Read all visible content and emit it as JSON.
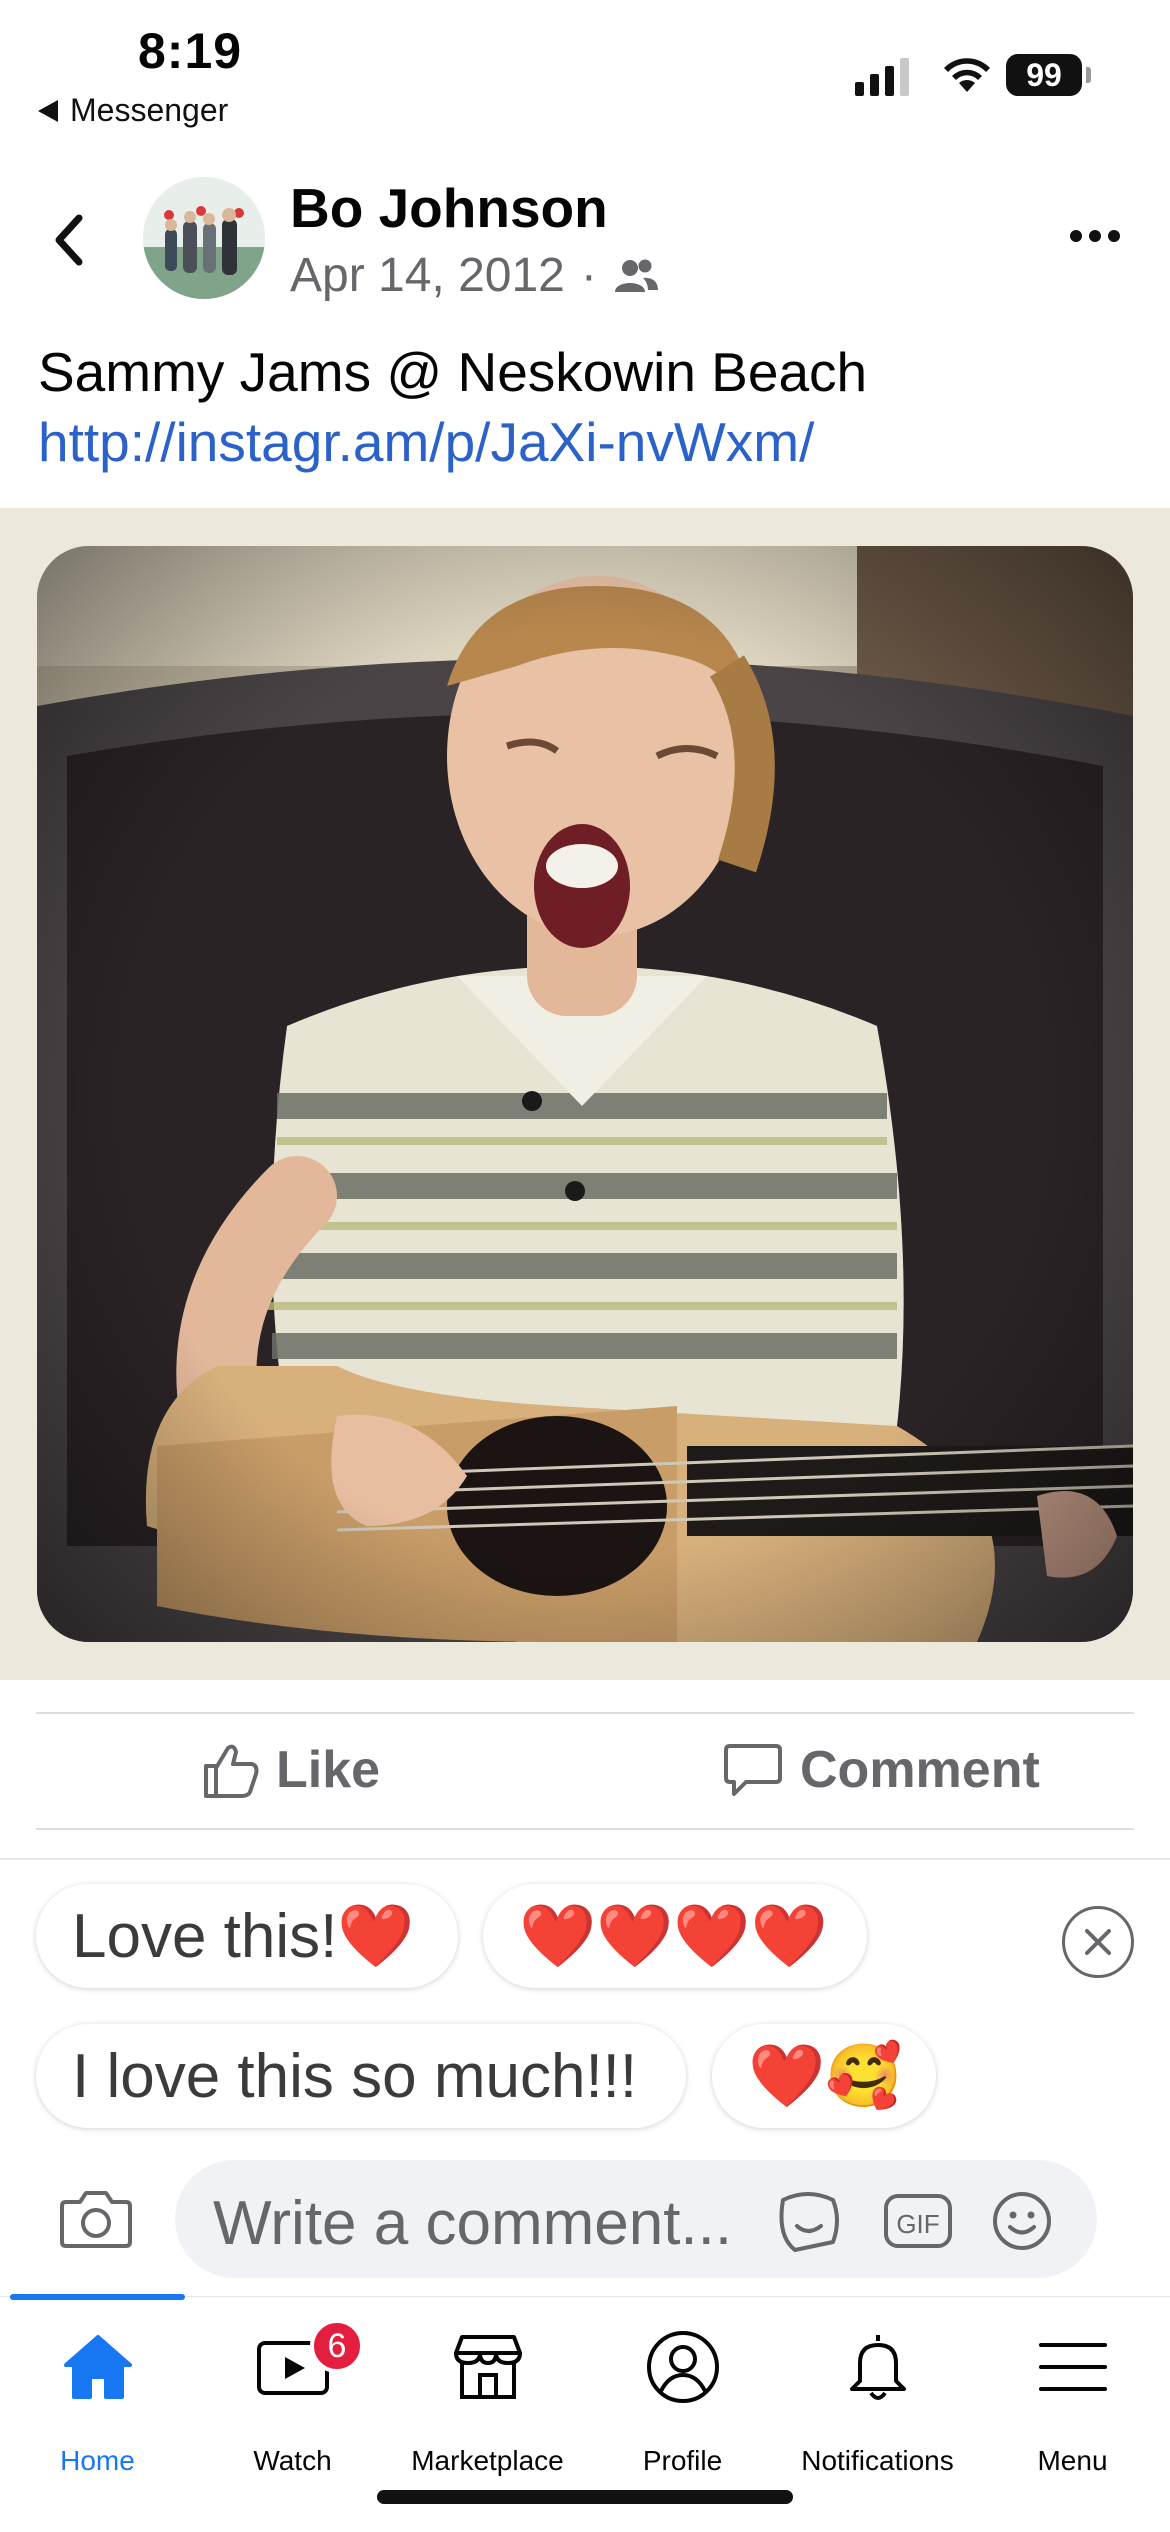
{
  "status_bar": {
    "time": "8:19",
    "back_app_label": "Messenger",
    "battery": "99"
  },
  "post": {
    "author": "Bo Johnson",
    "date": "Apr 14, 2012",
    "meta_separator": "·",
    "audience_icon": "friends-icon",
    "caption_text": "Sammy Jams @ Neskowin Beach ",
    "caption_link": "http://instagr.am/p/JaXi-nvWxm/"
  },
  "actions": {
    "like_label": "Like",
    "comment_label": "Comment"
  },
  "suggestions": [
    {
      "text": "Love this!❤️"
    },
    {
      "text": "❤️❤️❤️❤️"
    },
    {
      "text": "I love this so much!!!"
    },
    {
      "text": "❤️🥰"
    }
  ],
  "comment_box": {
    "placeholder": "Write a comment...",
    "gif_label": "GIF"
  },
  "tabs": [
    {
      "label": "Home",
      "icon": "home-icon",
      "active": true
    },
    {
      "label": "Watch",
      "icon": "watch-icon",
      "badge": "6"
    },
    {
      "label": "Marketplace",
      "icon": "marketplace-icon"
    },
    {
      "label": "Profile",
      "icon": "profile-icon"
    },
    {
      "label": "Notifications",
      "icon": "bell-icon"
    },
    {
      "label": "Menu",
      "icon": "menu-icon"
    }
  ],
  "colors": {
    "accent": "#1877f2",
    "link": "#2b62c9",
    "secondary_text": "#65676b",
    "badge": "#e41e3f"
  }
}
